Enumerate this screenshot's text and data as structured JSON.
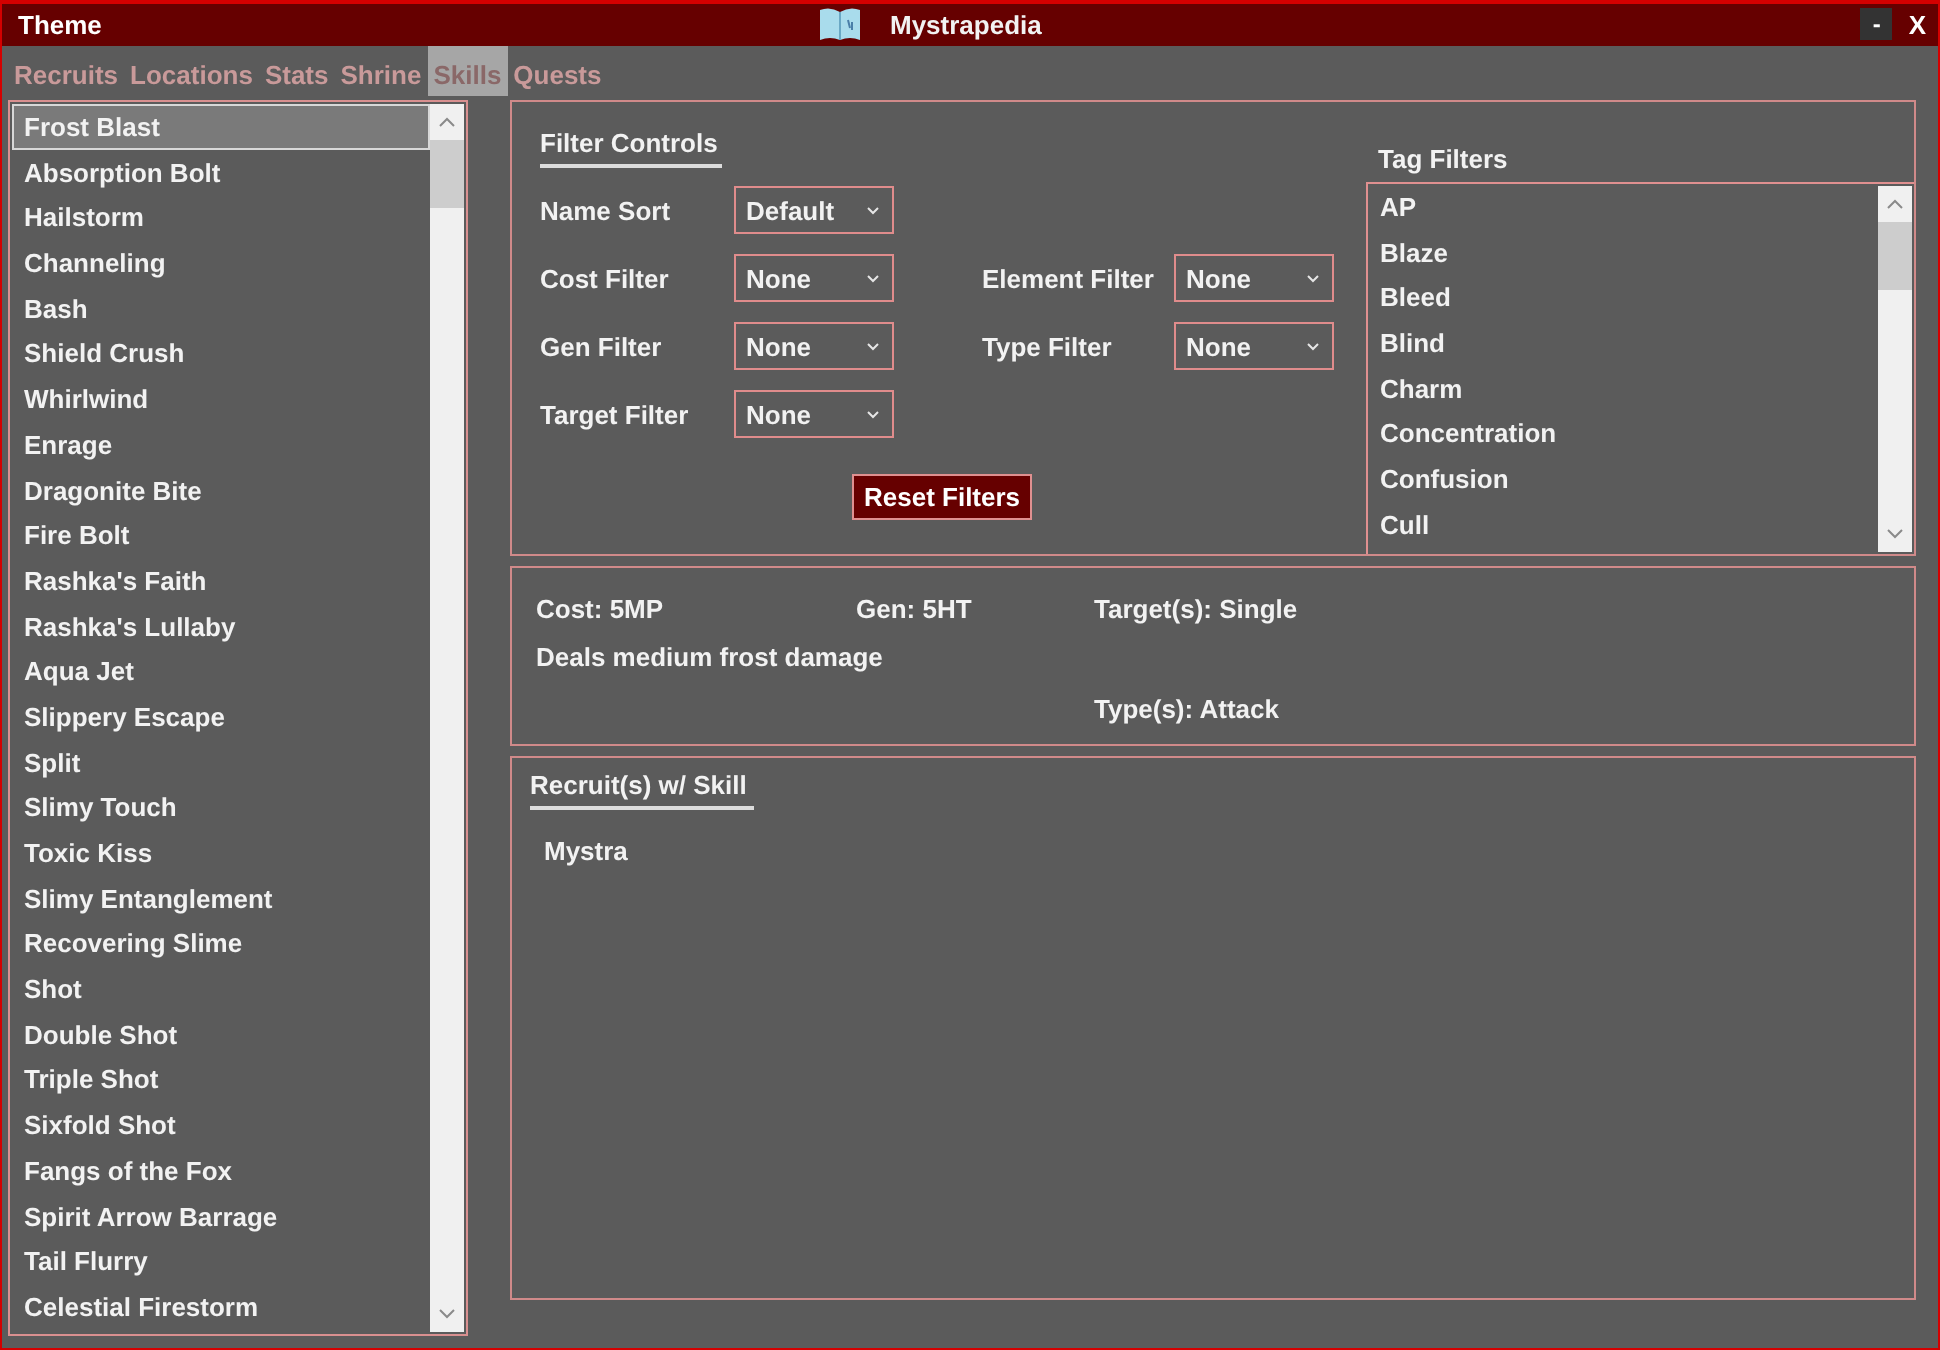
{
  "window": {
    "menu": "Theme",
    "title": "Mystrapedia",
    "minimize": "-",
    "close": "X"
  },
  "tabs": [
    {
      "label": "Recruits",
      "selected": false
    },
    {
      "label": "Locations",
      "selected": false
    },
    {
      "label": "Stats",
      "selected": false
    },
    {
      "label": "Shrine",
      "selected": false
    },
    {
      "label": "Skills",
      "selected": true
    },
    {
      "label": "Quests",
      "selected": false
    }
  ],
  "skills": [
    {
      "name": "Frost Blast",
      "selected": true
    },
    {
      "name": "Absorption Bolt",
      "selected": false
    },
    {
      "name": "Hailstorm",
      "selected": false
    },
    {
      "name": "Channeling",
      "selected": false
    },
    {
      "name": "Bash",
      "selected": false
    },
    {
      "name": "Shield Crush",
      "selected": false
    },
    {
      "name": "Whirlwind",
      "selected": false
    },
    {
      "name": "Enrage",
      "selected": false
    },
    {
      "name": "Dragonite Bite",
      "selected": false
    },
    {
      "name": "Fire Bolt",
      "selected": false
    },
    {
      "name": "Rashka's Faith",
      "selected": false
    },
    {
      "name": "Rashka's Lullaby",
      "selected": false
    },
    {
      "name": "Aqua Jet",
      "selected": false
    },
    {
      "name": "Slippery Escape",
      "selected": false
    },
    {
      "name": "Split",
      "selected": false
    },
    {
      "name": "Slimy Touch",
      "selected": false
    },
    {
      "name": "Toxic Kiss",
      "selected": false
    },
    {
      "name": "Slimy Entanglement",
      "selected": false
    },
    {
      "name": "Recovering Slime",
      "selected": false
    },
    {
      "name": "Shot",
      "selected": false
    },
    {
      "name": "Double Shot",
      "selected": false
    },
    {
      "name": "Triple Shot",
      "selected": false
    },
    {
      "name": "Sixfold Shot",
      "selected": false
    },
    {
      "name": "Fangs of the Fox",
      "selected": false
    },
    {
      "name": "Spirit Arrow Barrage",
      "selected": false
    },
    {
      "name": "Tail Flurry",
      "selected": false
    },
    {
      "name": "Celestial Firestorm",
      "selected": false
    }
  ],
  "filter_controls": {
    "title": "Filter Controls",
    "left_filters": [
      {
        "label": "Name Sort",
        "value": "Default"
      },
      {
        "label": "Cost Filter",
        "value": "None"
      },
      {
        "label": "Gen Filter",
        "value": "None"
      },
      {
        "label": "Target Filter",
        "value": "None"
      }
    ],
    "right_filters": [
      {
        "label": "Element Filter",
        "value": "None"
      },
      {
        "label": "Type Filter",
        "value": "None"
      }
    ],
    "reset_button": "Reset Filters"
  },
  "tag_filters": {
    "title": "Tag Filters",
    "tags": [
      "AP",
      "Blaze",
      "Bleed",
      "Blind",
      "Charm",
      "Concentration",
      "Confusion",
      "Cull"
    ]
  },
  "details": {
    "cost": "Cost: 5MP",
    "gen": "Gen: 5HT",
    "targets": "Target(s): Single",
    "description": "Deals medium frost damage",
    "types": "Type(s): Attack"
  },
  "recruits": {
    "title": "Recruit(s) w/ Skill",
    "names": [
      "Mystra"
    ]
  }
}
